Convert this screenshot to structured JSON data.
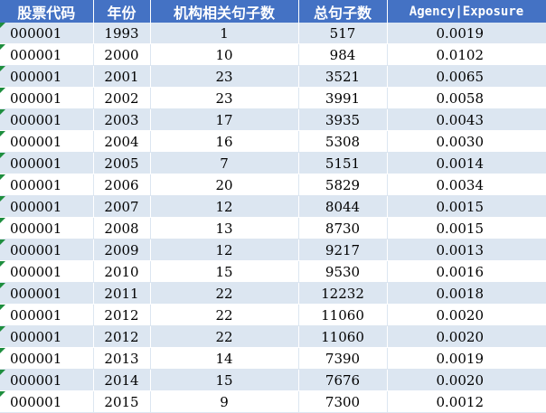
{
  "headers": [
    "股票代码",
    "年份",
    "机构相关句子数",
    "总句子数",
    "Agency|Exposure"
  ],
  "rows": [
    [
      "000001",
      "1993",
      "1",
      "517",
      "0.0019"
    ],
    [
      "000001",
      "2000",
      "10",
      "984",
      "0.0102"
    ],
    [
      "000001",
      "2001",
      "23",
      "3521",
      "0.0065"
    ],
    [
      "000001",
      "2002",
      "23",
      "3991",
      "0.0058"
    ],
    [
      "000001",
      "2003",
      "17",
      "3935",
      "0.0043"
    ],
    [
      "000001",
      "2004",
      "16",
      "5308",
      "0.0030"
    ],
    [
      "000001",
      "2005",
      "7",
      "5151",
      "0.0014"
    ],
    [
      "000001",
      "2006",
      "20",
      "5829",
      "0.0034"
    ],
    [
      "000001",
      "2007",
      "12",
      "8044",
      "0.0015"
    ],
    [
      "000001",
      "2008",
      "13",
      "8730",
      "0.0015"
    ],
    [
      "000001",
      "2009",
      "12",
      "9217",
      "0.0013"
    ],
    [
      "000001",
      "2010",
      "15",
      "9530",
      "0.0016"
    ],
    [
      "000001",
      "2011",
      "22",
      "12232",
      "0.0018"
    ],
    [
      "000001",
      "2012",
      "22",
      "11060",
      "0.0020"
    ],
    [
      "000001",
      "2012",
      "22",
      "11060",
      "0.0020"
    ],
    [
      "000001",
      "2013",
      "14",
      "7390",
      "0.0019"
    ],
    [
      "000001",
      "2014",
      "15",
      "7676",
      "0.0020"
    ],
    [
      "000001",
      "2015",
      "9",
      "7300",
      "0.0012"
    ]
  ],
  "colors": {
    "header_bg": "#4472c4",
    "header_text": "#ffffff",
    "band_bg": "#dce6f1",
    "plain_bg": "#ffffff",
    "error_marker": "#1e8e3e"
  }
}
